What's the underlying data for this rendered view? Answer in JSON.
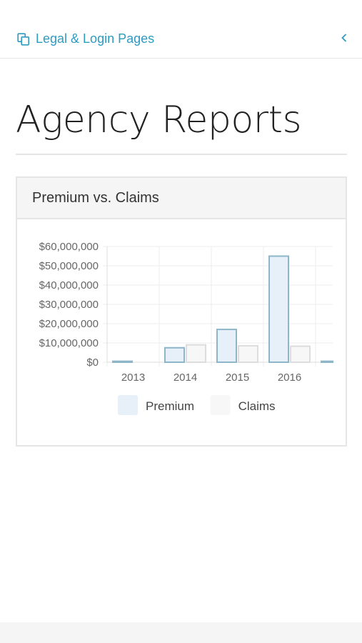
{
  "nav": {
    "breadcrumb": "Legal & Login Pages"
  },
  "page": {
    "title": "Agency Reports"
  },
  "panel": {
    "heading": "Premium vs. Claims"
  },
  "chart_data": {
    "type": "bar",
    "title": "",
    "categories": [
      "2013",
      "2014",
      "2015",
      "2016",
      ""
    ],
    "series": [
      {
        "name": "Premium",
        "values": [
          500000,
          7500000,
          17000000,
          55000000,
          500000
        ],
        "fill": "#e7eff8",
        "stroke": "#8db6c9"
      },
      {
        "name": "Claims",
        "values": [
          0,
          9000000,
          8500000,
          8300000,
          null
        ],
        "fill": "#f7f7f7",
        "stroke": "#dddddd"
      }
    ],
    "yticks": [
      "$0",
      "$10,000,000",
      "$20,000,000",
      "$30,000,000",
      "$40,000,000",
      "$50,000,000",
      "$60,000,000"
    ],
    "ylim": [
      0,
      60000000
    ],
    "grid": true,
    "legend": "bottom-center",
    "xlabel": "",
    "ylabel": ""
  },
  "colors": {
    "accent": "#2e9bc0",
    "title": "#222222",
    "tick_text": "#666666",
    "grid": "#eeeeee"
  },
  "icons": {
    "breadcrumb": "copy-pages-icon",
    "collapse": "chevron-left-icon"
  }
}
